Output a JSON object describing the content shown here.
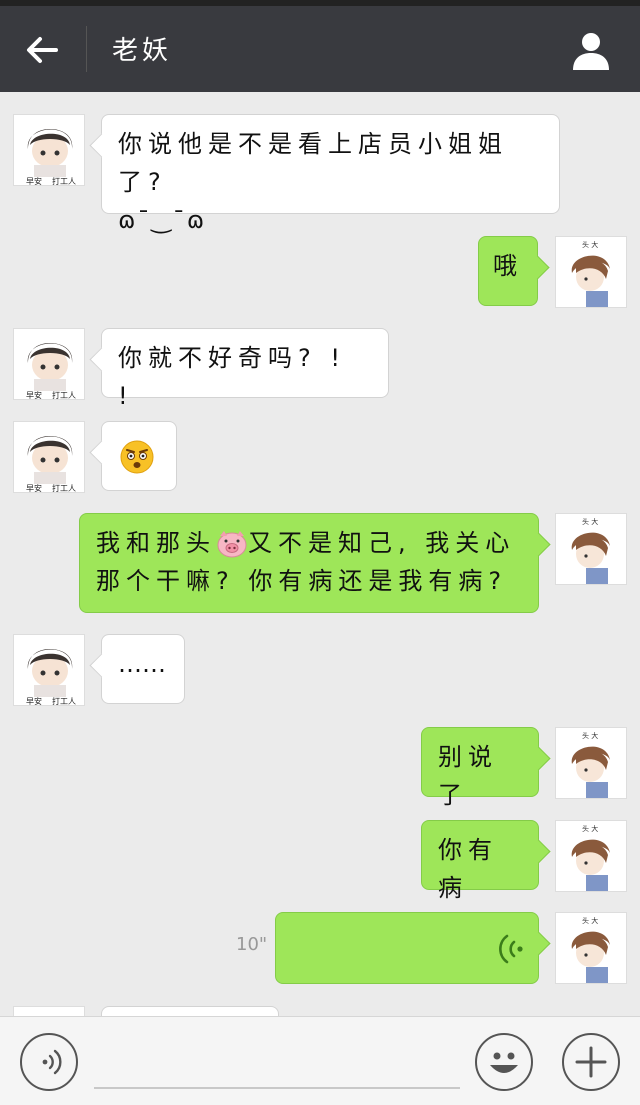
{
  "header": {
    "title": "老妖"
  },
  "messages": [
    {
      "side": "in",
      "text_line1": "你说他是不是看上店员小姐姐了?",
      "text_line2": "ɷ¯‿¯ɷ"
    },
    {
      "side": "out",
      "text": "哦"
    },
    {
      "side": "in",
      "text": "你就不好奇吗? ! !"
    },
    {
      "side": "in",
      "emoji": "shocked-face-emoji"
    },
    {
      "side": "out",
      "text_part1": "我和那头",
      "emoji": "pig-emoji",
      "text_part2": "又不是知己, 我关心",
      "text_line2": "那个干嘛? 你有病还是我有病?"
    },
    {
      "side": "in",
      "text": "……"
    },
    {
      "side": "out",
      "text": "别说了"
    },
    {
      "side": "out",
      "text": "你有病"
    },
    {
      "side": "out",
      "type": "voice",
      "duration": "10\""
    }
  ],
  "avatars": {
    "contact_caption_left": "早安",
    "contact_caption_right": "打工人",
    "self_caption": "头 大"
  },
  "colors": {
    "topbar": "#393a3f",
    "outgoing_bubble": "#9ee659",
    "incoming_bubble": "#ffffff",
    "chat_bg": "#ebebeb"
  },
  "bottom_bar": {
    "left_icon": "voice-mode-icon",
    "emoji_icon": "smiley-icon",
    "plus_icon": "plus-icon"
  }
}
